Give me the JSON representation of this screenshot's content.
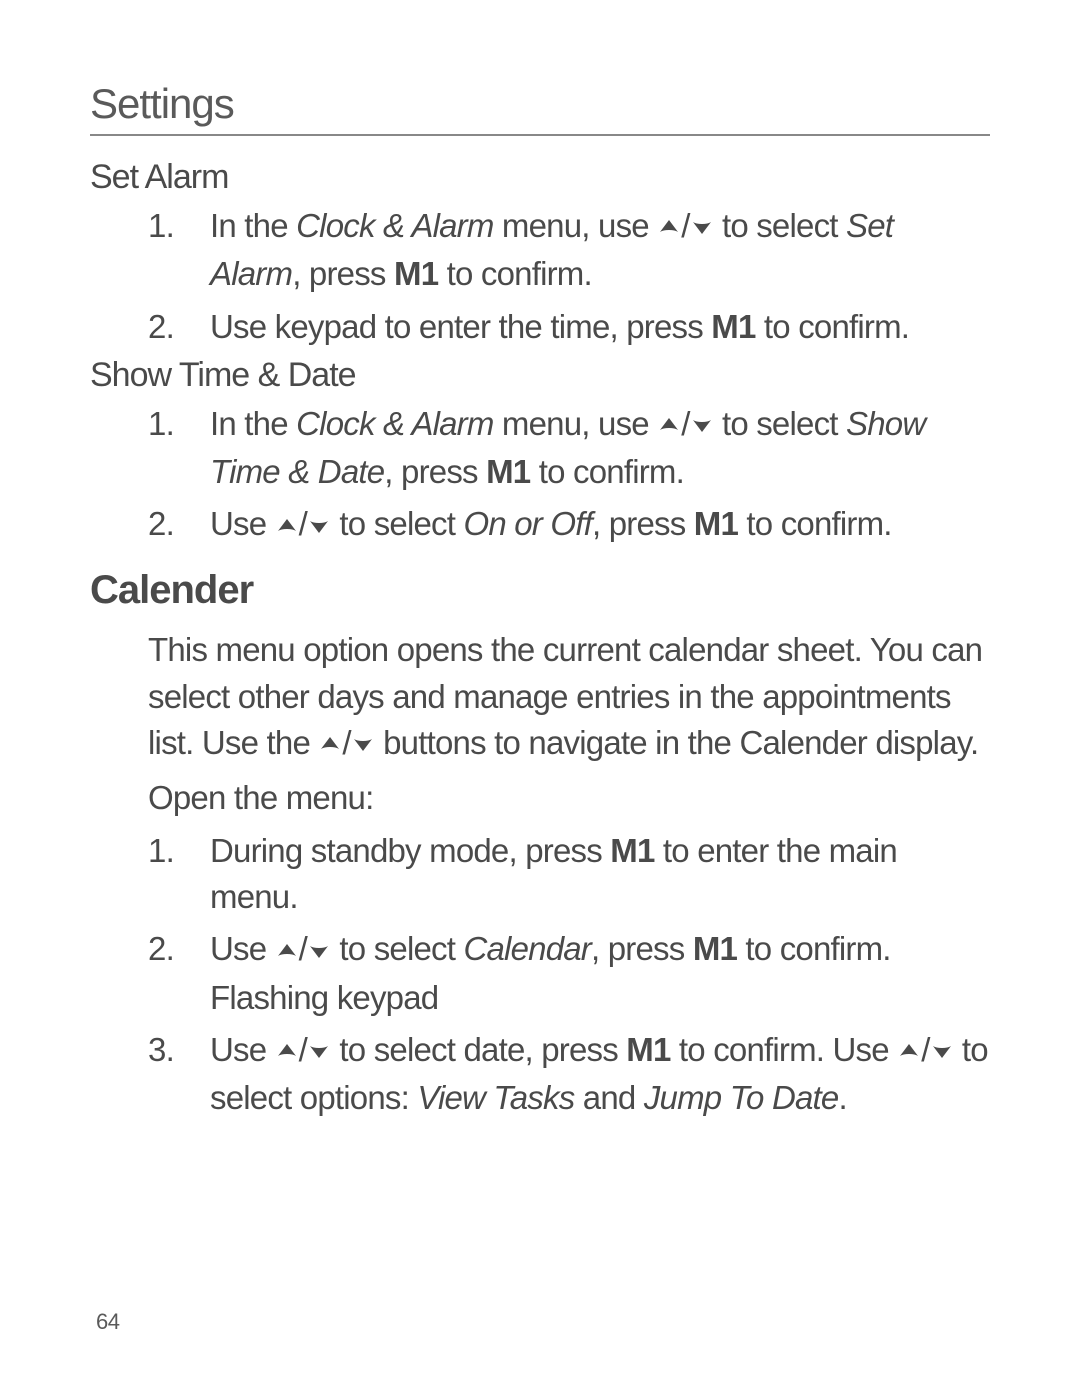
{
  "heading_settings": "Settings",
  "subsection_set_alarm": "Set Alarm",
  "set_alarm": {
    "step1_p1": "In the ",
    "step1_italic1": "Clock & Alarm",
    "step1_p2": " menu, use ",
    "step1_p3": " to select ",
    "step1_italic2": "Set Alarm",
    "step1_p4": ", press ",
    "step1_bold1": "M1",
    "step1_p5": " to confirm.",
    "step2_p1": "Use keypad to enter the time, press ",
    "step2_bold1": "M1",
    "step2_p2": " to confirm."
  },
  "subsection_show_time": "Show Time & Date",
  "show_time": {
    "step1_p1": "In the ",
    "step1_italic1": "Clock & Alarm",
    "step1_p2": " menu, use ",
    "step1_p3": " to select ",
    "step1_italic2": "Show Time & Date",
    "step1_p4": ", press ",
    "step1_bold1": "M1",
    "step1_p5": " to confirm.",
    "step2_p1": "Use ",
    "step2_p2": " to select ",
    "step2_italic1": "On or Off",
    "step2_p3": ", press ",
    "step2_bold1": "M1",
    "step2_p4": " to confirm."
  },
  "heading_calender": "Calender",
  "calender": {
    "intro_p1": "This menu option opens the current calendar sheet. You can select other days and manage entries in the appointments list. Use the ",
    "intro_p2": " buttons to navigate in the Calender display.",
    "open_menu": "Open the menu:",
    "step1_p1": "During standby mode, press ",
    "step1_bold1": "M1",
    "step1_p2": " to enter the main menu.",
    "step2_p1": "Use ",
    "step2_p2": " to select ",
    "step2_italic1": "Calendar",
    "step2_p3": ", press ",
    "step2_bold1": "M1",
    "step2_p4": " to confirm. Flashing keypad",
    "step3_p1": "Use ",
    "step3_p2": " to select date, press ",
    "step3_bold1": "M1",
    "step3_p3": " to confirm. Use ",
    "step3_p4": " to select options: ",
    "step3_italic1": "View Tasks",
    "step3_p5": " and ",
    "step3_italic2": "Jump To Date",
    "step3_p6": "."
  },
  "page_number": "64"
}
